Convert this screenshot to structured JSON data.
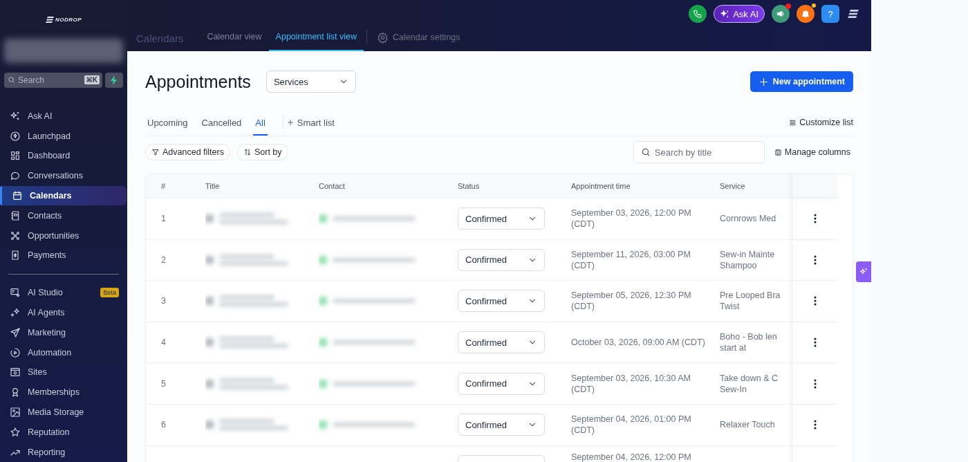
{
  "sidebar": {
    "logo": "NODROP",
    "search": {
      "placeholder": "Search",
      "shortcut": "⌘K"
    },
    "nav": [
      {
        "label": "Ask AI",
        "selected": false
      },
      {
        "label": "Launchpad",
        "selected": false
      },
      {
        "label": "Dashboard",
        "selected": false
      },
      {
        "label": "Conversations",
        "selected": false
      },
      {
        "label": "Calendars",
        "selected": true
      },
      {
        "label": "Contacts",
        "selected": false
      },
      {
        "label": "Opportunities",
        "selected": false
      },
      {
        "label": "Payments",
        "selected": false
      }
    ],
    "nav_secondary": [
      {
        "label": "AI Studio",
        "badge": "Beta",
        "selected": false
      },
      {
        "label": "AI Agents",
        "selected": false
      },
      {
        "label": "Marketing",
        "selected": false
      },
      {
        "label": "Automation",
        "selected": false
      },
      {
        "label": "Sites",
        "selected": false
      },
      {
        "label": "Memberships",
        "selected": false
      },
      {
        "label": "Media Storage",
        "selected": false
      },
      {
        "label": "Reputation",
        "selected": false
      },
      {
        "label": "Reporting",
        "selected": false
      }
    ]
  },
  "header": {
    "title": "Calendars",
    "tabs": [
      {
        "label": "Calendar view",
        "selected": false
      },
      {
        "label": "Appointment list view",
        "selected": true
      }
    ],
    "settings": "Calendar settings",
    "ask_ai": "Ask AI",
    "help": "?"
  },
  "page": {
    "title": "Appointments",
    "category_dropdown": "Services",
    "new_button": "New appointment",
    "tabs": [
      {
        "label": "Upcoming",
        "selected": false
      },
      {
        "label": "Cancelled",
        "selected": false
      },
      {
        "label": "All",
        "selected": true
      }
    ],
    "smart_list": "Smart list",
    "customize": "Customize list",
    "advanced_filters": "Advanced filters",
    "sort_by": "Sort by",
    "search": {
      "placeholder": "Search by title"
    },
    "manage_columns": "Manage columns"
  },
  "table": {
    "columns": [
      "#",
      "Title",
      "Contact",
      "Status",
      "Appointment time",
      "Service"
    ],
    "rows": [
      {
        "number": "1",
        "status": "Confirmed",
        "time": "September 03, 2026, 12:00 PM\n(CDT)",
        "service": "Cornrows Med"
      },
      {
        "number": "2",
        "status": "Confirmed",
        "time": "September 11, 2026, 03:00 PM\n(CDT)",
        "service": "Sew-in Mainte\nShampoo"
      },
      {
        "number": "3",
        "status": "Confirmed",
        "time": "September 05, 2026, 12:30 PM\n(CDT)",
        "service": "Pre Looped Bra\nTwist"
      },
      {
        "number": "4",
        "status": "Confirmed",
        "time": "October 03, 2026, 09:00 AM (CDT)",
        "service": "Boho - Bob len\nstart at"
      },
      {
        "number": "5",
        "status": "Confirmed",
        "time": "September 03, 2026, 10:30 AM\n(CDT)",
        "service": "Take down & C\nSew-In"
      },
      {
        "number": "6",
        "status": "Confirmed",
        "time": "September 04, 2026, 01:00 PM\n(CDT)",
        "service": "Relaxer Touch"
      },
      {
        "time": "September 04, 2026, 12:00 PM"
      }
    ]
  }
}
